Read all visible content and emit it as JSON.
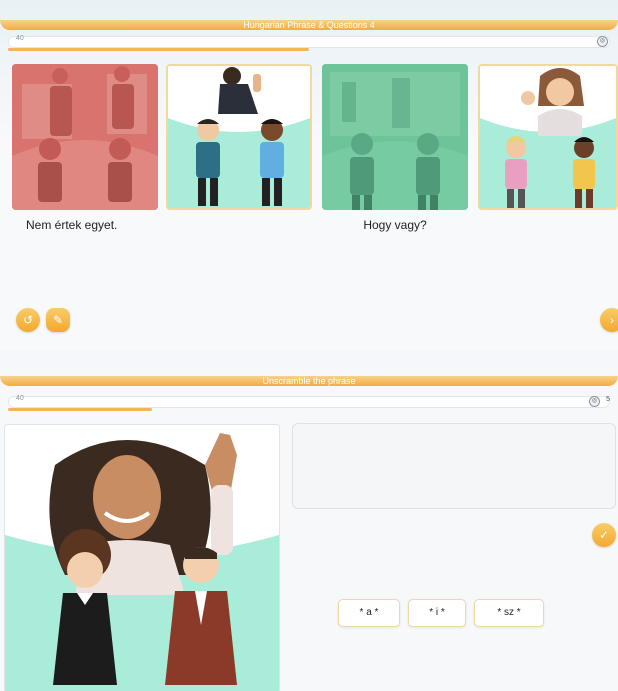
{
  "panel1": {
    "title": "Hungarian Phrase & Questions 4",
    "progress_count": "40",
    "progress_fraction": 0.5,
    "progress_end_icon": "target-icon",
    "cards": [
      {
        "caption": "Nem értek egyet.",
        "style": "red",
        "icon": "office-argument-illustration"
      },
      {
        "caption": "",
        "style": "white",
        "icon": "greeting-illustration"
      },
      {
        "caption": "Hogy vagy?",
        "style": "green",
        "icon": "conversation-illustration"
      },
      {
        "caption": "",
        "style": "white",
        "icon": "ok-gesture-illustration"
      }
    ],
    "buttons": {
      "back_icon": "back-icon",
      "hint_icon": "hint-icon",
      "next_icon": "next-icon"
    }
  },
  "panel2": {
    "title": "Unscramble the phrase",
    "progress_count": "40",
    "progress_right_num": "5",
    "progress_fraction": 0.24,
    "chips": [
      "* a *",
      "* i *",
      "* sz *"
    ],
    "check_icon": "check-icon",
    "image_icon": "waving-hello-illustration"
  },
  "colors": {
    "accent": "#f3a833",
    "mint": "#a9ecd9",
    "red_card": "#d9736e",
    "green_card": "#6dc499"
  }
}
